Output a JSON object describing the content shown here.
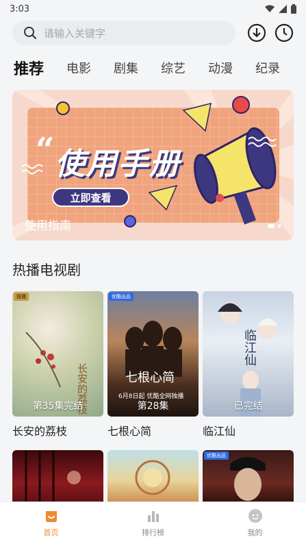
{
  "status_bar": {
    "time": "3:03"
  },
  "search": {
    "placeholder": "请输入关键字"
  },
  "tabs": [
    {
      "label": "推荐",
      "active": true
    },
    {
      "label": "电影"
    },
    {
      "label": "剧集"
    },
    {
      "label": "综艺"
    },
    {
      "label": "动漫"
    },
    {
      "label": "纪录"
    }
  ],
  "banner": {
    "title": "使用手册",
    "button_label": "立即查看",
    "caption": "使用指南"
  },
  "section": {
    "title": "热播电视剧"
  },
  "shows": [
    {
      "title": "长安的荔枝",
      "status": "第35集完结",
      "poster_text": "长安的荔枝"
    },
    {
      "title": "七根心简",
      "status": "第28集",
      "poster_text": "七根心简",
      "poster_sub": "6月8日起 优酷全网独播"
    },
    {
      "title": "临江仙",
      "status": "已完结",
      "poster_text": "临江仙"
    }
  ],
  "bottom_nav": [
    {
      "label": "首页",
      "icon": "home-icon",
      "active": true
    },
    {
      "label": "排行榜",
      "icon": "ranking-icon"
    },
    {
      "label": "我的",
      "icon": "profile-icon"
    }
  ],
  "colors": {
    "accent": "#f08a2e",
    "banner_bg": "#f0a47d",
    "banner_button": "#3d3780"
  }
}
